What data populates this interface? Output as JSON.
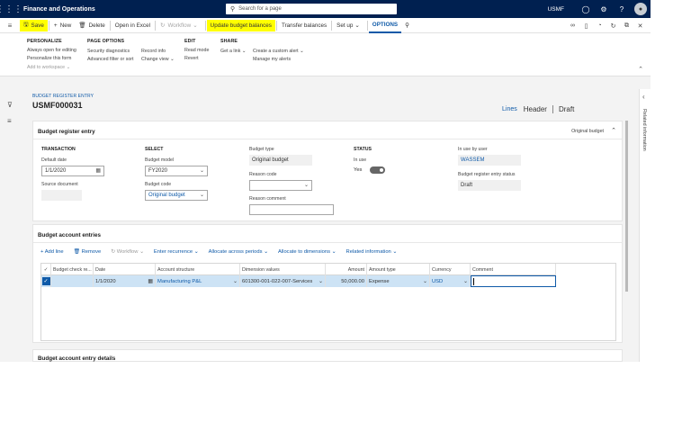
{
  "topbar": {
    "app_title": "Finance and Operations",
    "search_placeholder": "Search for a page",
    "company": "USMF",
    "notification_count": "0"
  },
  "actionbar": {
    "save": "Save",
    "new": "New",
    "delete": "Delete",
    "open_in_excel": "Open in Excel",
    "workflow": "Workflow",
    "update_budget_balances": "Update budget balances",
    "transfer_balances": "Transfer balances",
    "set_up": "Set up",
    "options": "OPTIONS"
  },
  "ribbon": {
    "personalize": {
      "header": "PERSONALIZE",
      "items": [
        "Always open for editing",
        "Personalize this form",
        "Add to workspace"
      ]
    },
    "page_options": {
      "header": "PAGE OPTIONS",
      "col1": [
        "Security diagnostics",
        "Advanced filter or sort"
      ],
      "col2": [
        "Record info",
        "Change view"
      ]
    },
    "edit": {
      "header": "EDIT",
      "items": [
        "Read mode",
        "Revert"
      ]
    },
    "share": {
      "header": "SHARE",
      "col1": [
        "Get a link"
      ],
      "col2": [
        "Create a custom alert",
        "Manage my alerts"
      ]
    }
  },
  "page": {
    "breadcrumb": "BUDGET REGISTER ENTRY",
    "record_id": "USMF000031",
    "views": [
      "Lines",
      "Header",
      "Draft"
    ]
  },
  "right_panel": {
    "label": "Related information"
  },
  "entry_panel": {
    "title": "Budget register entry",
    "summary": "Original budget",
    "transaction": {
      "header": "TRANSACTION",
      "default_date_label": "Default date",
      "default_date_value": "1/1/2020",
      "source_document_label": "Source document",
      "source_document_value": ""
    },
    "select": {
      "header": "SELECT",
      "budget_model_label": "Budget model",
      "budget_model_value": "FY2020",
      "budget_code_label": "Budget code",
      "budget_code_value": "Original budget"
    },
    "type": {
      "budget_type_label": "Budget type",
      "budget_type_value": "Original budget",
      "reason_code_label": "Reason code",
      "reason_code_value": "",
      "reason_comment_label": "Reason comment",
      "reason_comment_value": ""
    },
    "status": {
      "header": "STATUS",
      "in_use_label": "In use",
      "in_use_value": "Yes"
    },
    "user": {
      "in_use_by_label": "In use by user",
      "in_use_by_value": "WASSEM",
      "entry_status_label": "Budget register entry status",
      "entry_status_value": "Draft"
    }
  },
  "accounts_panel": {
    "title": "Budget account entries",
    "toolbar": [
      "Add line",
      "Remove",
      "Workflow",
      "Enter recurrence",
      "Allocate across periods",
      "Allocate to dimensions",
      "Related information"
    ],
    "columns": [
      "Budget check re...",
      "Date",
      "Account structure",
      "Dimension values",
      "Amount",
      "Amount type",
      "Currency",
      "Comment"
    ],
    "rows": [
      {
        "budget_check": "",
        "date": "1/1/2020",
        "account_structure": "Manufacturing P&L",
        "dimension_values": "601300-001-022-007-Services",
        "amount": "50,000.00",
        "amount_type": "Expense",
        "currency": "USD",
        "comment": ""
      }
    ]
  },
  "details_panel": {
    "title": "Budget account entry details"
  },
  "colors": {
    "nav": "#002050",
    "accent": "#0f5aa8",
    "highlight": "#ffff00",
    "selected_row": "#cde3f5"
  }
}
